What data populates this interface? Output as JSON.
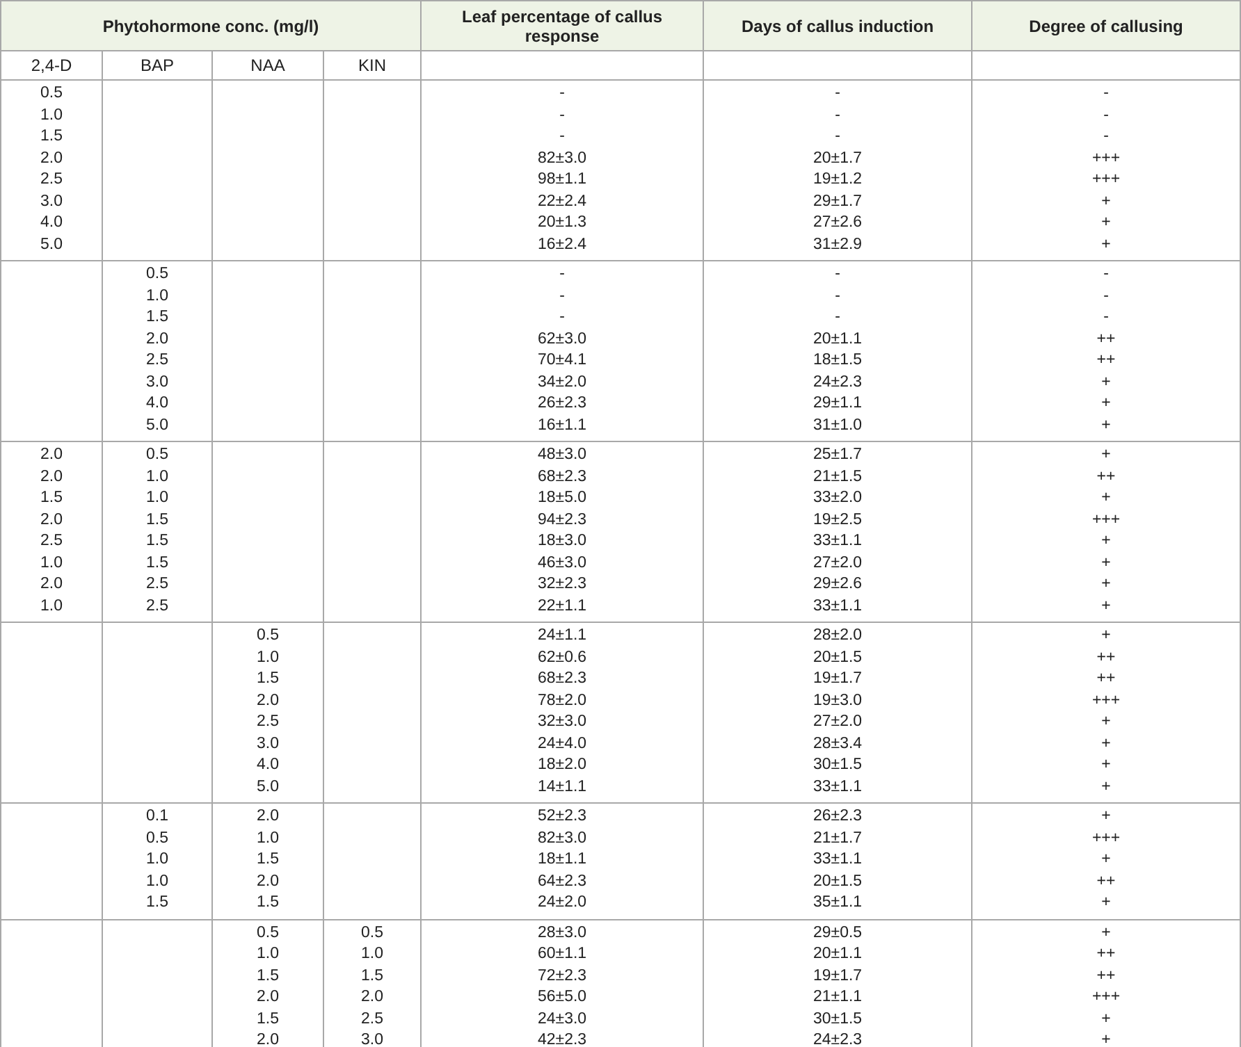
{
  "table": {
    "header": {
      "conc_title": "Phytohormone conc. (mg/l)",
      "columns": [
        "Leaf percentage of callus response",
        "Days of callus induction",
        "Degree of callusing"
      ]
    },
    "subheader": [
      "2,4-D",
      "BAP",
      "NAA",
      "KIN"
    ],
    "groups": [
      {
        "d24": [
          "0.5",
          "1.0",
          "1.5",
          "2.0",
          "2.5",
          "3.0",
          "4.0",
          "5.0"
        ],
        "leaf": [
          "-",
          "-",
          "-",
          "82±3.0",
          "98±1.1",
          "22±2.4",
          "20±1.3",
          "16±2.4"
        ],
        "days": [
          "-",
          "-",
          "-",
          "20±1.7",
          "19±1.2",
          "29±1.7",
          "27±2.6",
          "31±2.9"
        ],
        "degree": [
          "-",
          "-",
          "-",
          "+++",
          "+++",
          "+",
          "+",
          "+"
        ]
      },
      {
        "bap": [
          "0.5",
          "1.0",
          "1.5",
          "2.0",
          "2.5",
          "3.0",
          "4.0",
          "5.0"
        ],
        "leaf": [
          "-",
          "-",
          "-",
          "62±3.0",
          "70±4.1",
          "34±2.0",
          "26±2.3",
          "16±1.1"
        ],
        "days": [
          "-",
          "-",
          "-",
          "20±1.1",
          "18±1.5",
          "24±2.3",
          "29±1.1",
          "31±1.0"
        ],
        "degree": [
          "-",
          "-",
          "-",
          "++",
          "++",
          "+",
          "+",
          "+"
        ]
      },
      {
        "d24": [
          "2.0",
          "2.0",
          "1.5",
          "2.0",
          "2.5",
          "1.0",
          "2.0",
          "1.0"
        ],
        "bap": [
          "0.5",
          "1.0",
          "1.0",
          "1.5",
          "1.5",
          "1.5",
          "2.5",
          "2.5"
        ],
        "leaf": [
          "48±3.0",
          "68±2.3",
          "18±5.0",
          "94±2.3",
          "18±3.0",
          "46±3.0",
          "32±2.3",
          "22±1.1"
        ],
        "days": [
          "25±1.7",
          "21±1.5",
          "33±2.0",
          "19±2.5",
          "33±1.1",
          "27±2.0",
          "29±2.6",
          "33±1.1"
        ],
        "degree": [
          "+",
          "++",
          "+",
          "+++",
          "+",
          "+",
          "+",
          "+"
        ]
      },
      {
        "naa": [
          "0.5",
          "1.0",
          "1.5",
          "2.0",
          "2.5",
          "3.0",
          "4.0",
          "5.0"
        ],
        "leaf": [
          "24±1.1",
          "62±0.6",
          "68±2.3",
          "78±2.0",
          "32±3.0",
          "24±4.0",
          "18±2.0",
          "14±1.1"
        ],
        "days": [
          "28±2.0",
          "20±1.5",
          "19±1.7",
          "19±3.0",
          "27±2.0",
          "28±3.4",
          "30±1.5",
          "33±1.1"
        ],
        "degree": [
          "+",
          "++",
          "++",
          "+++",
          "+",
          "+",
          "+",
          "+"
        ]
      },
      {
        "bap": [
          "0.1",
          "0.5",
          "1.0",
          "1.0",
          "1.5"
        ],
        "naa": [
          "2.0",
          "1.0",
          "1.5",
          "2.0",
          "1.5"
        ],
        "leaf": [
          "52±2.3",
          "82±3.0",
          "18±1.1",
          "64±2.3",
          "24±2.0"
        ],
        "days": [
          "26±2.3",
          "21±1.7",
          "33±1.1",
          "20±1.5",
          "35±1.1"
        ],
        "degree": [
          "+",
          "+++",
          "+",
          "++",
          "+"
        ]
      },
      {
        "naa": [
          "0.5",
          "1.0",
          "1.5",
          "2.0",
          "1.5",
          "2.0"
        ],
        "kin": [
          "0.5",
          "1.0",
          "1.5",
          "2.0",
          "2.5",
          "3.0"
        ],
        "leaf": [
          "28±3.0",
          "60±1.1",
          "72±2.3",
          "56±5.0",
          "24±3.0",
          "42±2.3"
        ],
        "days": [
          "29±0.5",
          "20±1.1",
          "19±1.7",
          "21±1.1",
          "30±1.5",
          "24±2.3"
        ],
        "degree": [
          "+",
          "++",
          "++",
          "+++",
          "+",
          "+"
        ]
      }
    ]
  }
}
